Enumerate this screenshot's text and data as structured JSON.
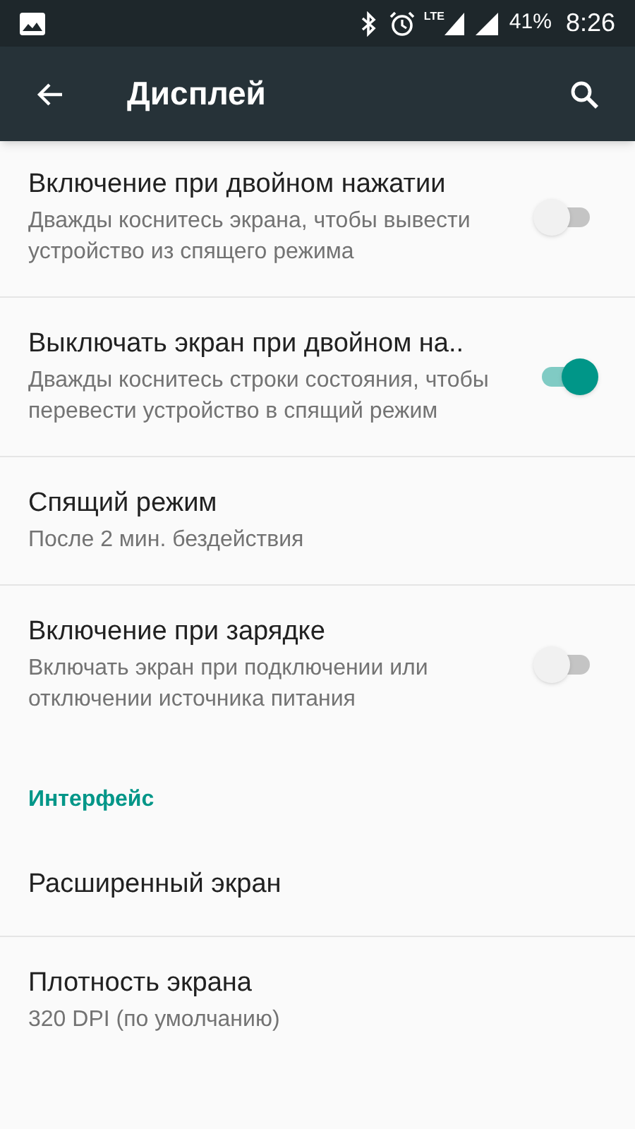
{
  "status_bar": {
    "network_label": "LTE",
    "battery": "41%",
    "time": "8:26"
  },
  "app_bar": {
    "title": "Дисплей"
  },
  "items": [
    {
      "kind": "switch",
      "title": "Включение при двойном нажатии",
      "summary": "Дважды коснитесь экрана, чтобы вывести устройство из спящего режима",
      "on": false
    },
    {
      "kind": "switch",
      "title": "Выключать экран при двойном на..",
      "summary": "Дважды коснитесь строки состояния, чтобы перевести устройство в спящий режим",
      "on": true
    },
    {
      "kind": "plain",
      "title": "Спящий режим",
      "summary": "После 2 мин. бездействия"
    },
    {
      "kind": "switch",
      "title": "Включение при зарядке",
      "summary": "Включать экран при подключении или отключении источника питания",
      "on": false
    },
    {
      "kind": "category",
      "title": "Интерфейс"
    },
    {
      "kind": "plain",
      "title": "Расширенный экран"
    },
    {
      "kind": "plain",
      "title": "Плотность экрана",
      "summary": "320 DPI (по умолчанию)"
    }
  ]
}
